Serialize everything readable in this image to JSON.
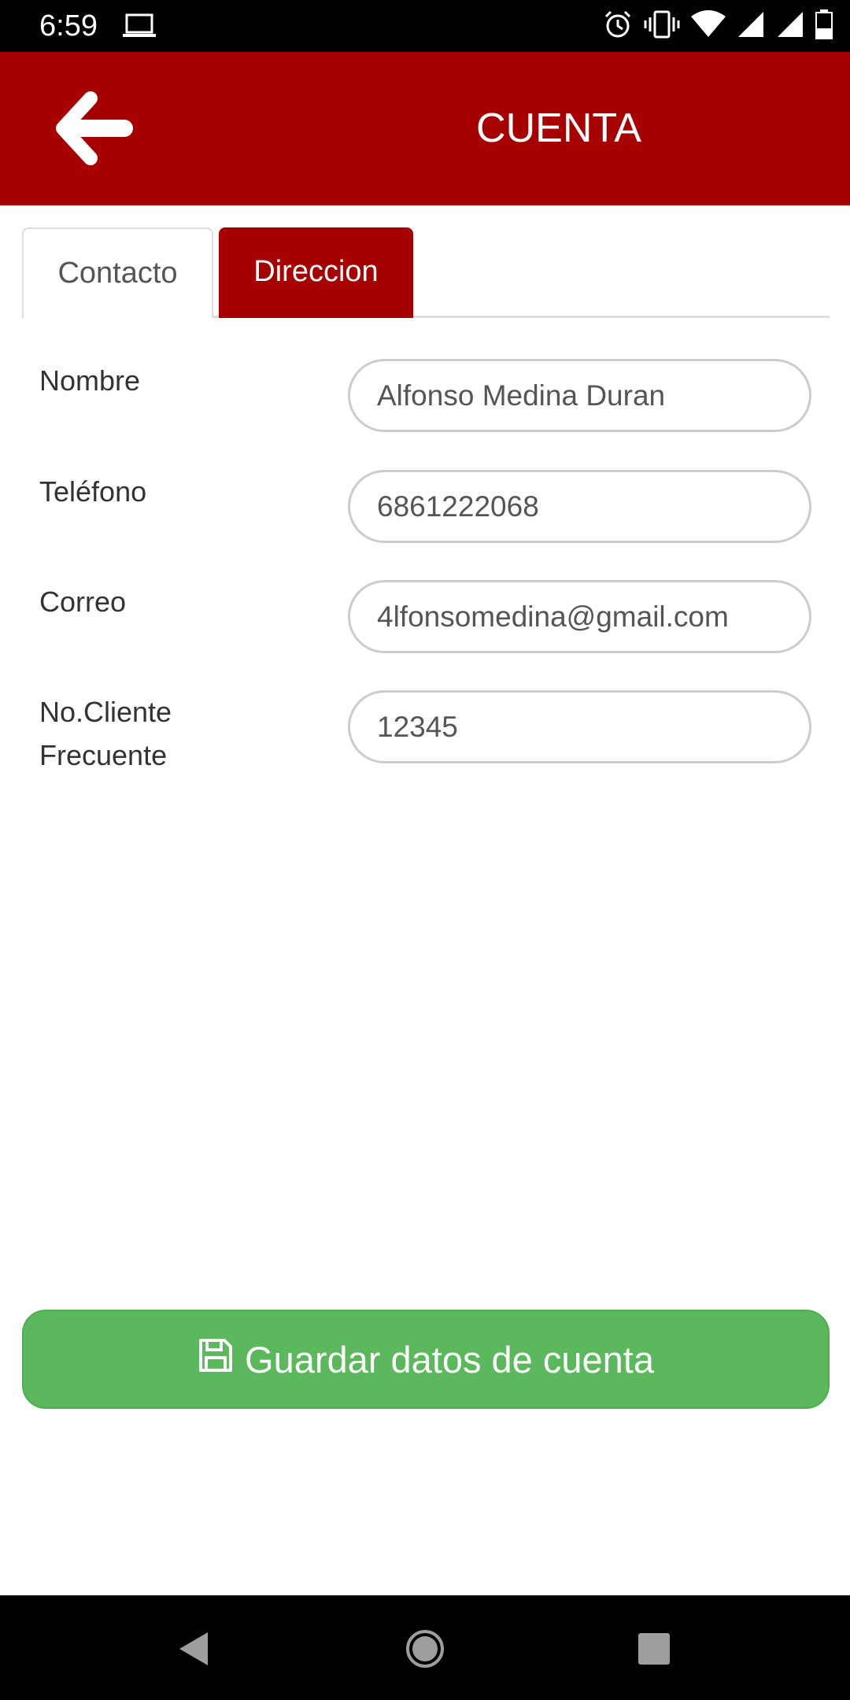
{
  "status_bar": {
    "time": "6:59",
    "icons": [
      "laptop-icon",
      "alarm-icon",
      "vibrate-icon",
      "wifi-icon",
      "signal-icon",
      "signal-icon",
      "battery-icon"
    ]
  },
  "app_bar": {
    "title": "CUENTA",
    "back_icon": "arrow-left-icon",
    "color": "#a60000"
  },
  "tabs": [
    {
      "label": "Contacto",
      "active": false
    },
    {
      "label": "Direccion",
      "active": true
    }
  ],
  "form": {
    "fields": [
      {
        "label": "Nombre",
        "value": "Alfonso Medina Duran"
      },
      {
        "label": "Teléfono",
        "value": "6861222068"
      },
      {
        "label": "Correo",
        "value": "4lfonsomedina@gmail.com"
      },
      {
        "label_line1": "No.Cliente",
        "label_line2": "Frecuente",
        "value": "12345"
      }
    ]
  },
  "save_button": {
    "label": "Guardar datos de cuenta",
    "icon": "floppy-disk-icon",
    "color": "#5cb85c"
  },
  "nav_bar": {
    "icons": [
      "back-triangle-icon",
      "home-circle-icon",
      "recents-square-icon"
    ]
  }
}
